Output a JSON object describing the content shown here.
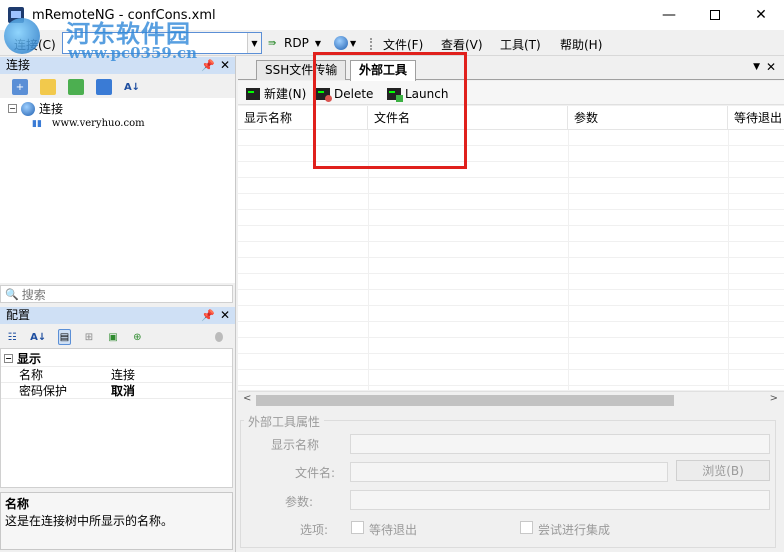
{
  "window": {
    "title": "mRemoteNG - confCons.xml",
    "minimize": "—",
    "close": "✕"
  },
  "watermark": {
    "cn": "河东软件园",
    "url": "www.pc0359.cn"
  },
  "toolbar": {
    "connect_label": "连接(C)",
    "combo_value": "",
    "rdp_label": "RDP",
    "menus": [
      "文件(F)",
      "查看(V)",
      "工具(T)",
      "帮助(H)"
    ]
  },
  "connections_panel": {
    "title": "连接",
    "tree_root": "连接",
    "tree_child": "www.veryhuo.com",
    "search_placeholder": "搜索"
  },
  "config_panel": {
    "title": "配置",
    "category": "显示",
    "rows": [
      {
        "name": "名称",
        "value": "连接"
      },
      {
        "name": "密码保护",
        "value": "取消"
      }
    ],
    "description_title": "名称",
    "description_text": "这是在连接树中所显示的名称。"
  },
  "tabs": [
    {
      "label": "SSH文件传输"
    },
    {
      "label": "外部工具"
    }
  ],
  "ext_toolbar": {
    "new_label": "新建(N)",
    "delete_label": "Delete",
    "launch_label": "Launch"
  },
  "grid": {
    "columns": [
      "显示名称",
      "文件名",
      "参数",
      "等待退出"
    ]
  },
  "properties": {
    "group_title": "外部工具属性",
    "display_name_label": "显示名称",
    "file_name_label": "文件名:",
    "browse_label": "浏览(B)",
    "params_label": "参数:",
    "options_label": "选项:",
    "wait_exit_label": "等待退出",
    "try_integrate_label": "尝试进行集成"
  },
  "colors": {
    "highlight_box": "#e0201c",
    "panel_header": "#cfe0f5"
  }
}
